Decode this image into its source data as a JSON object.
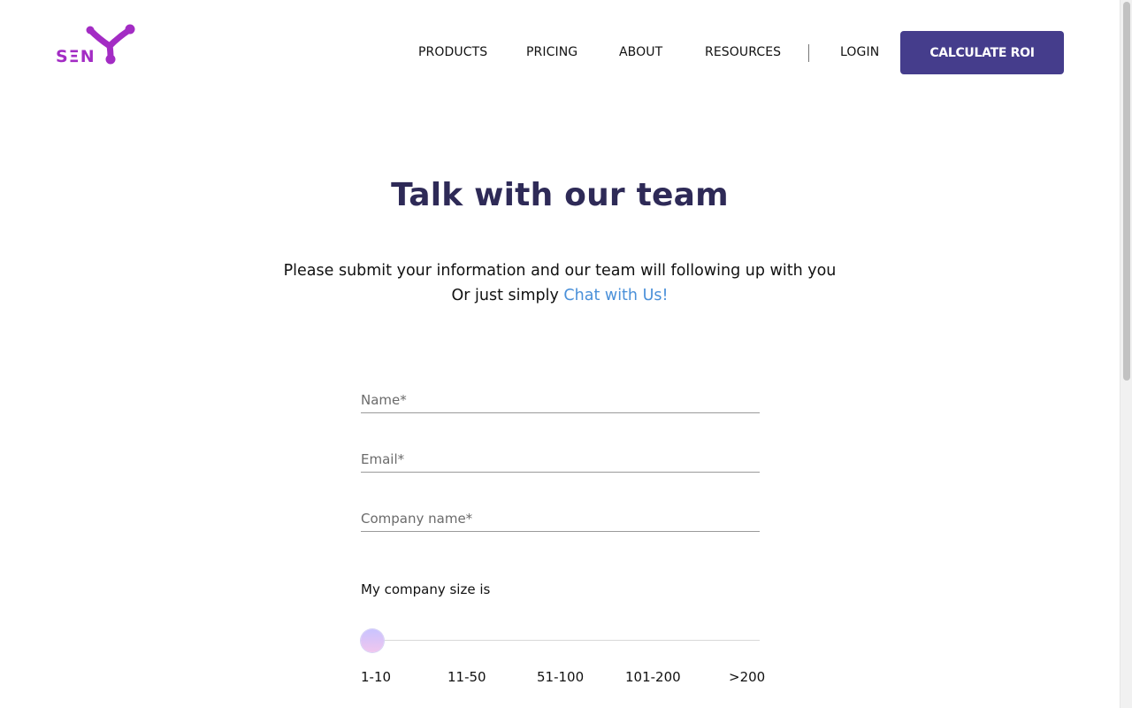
{
  "brand": {
    "logo_text": "SΞN",
    "accent": "#a32cc4"
  },
  "nav": {
    "products": "PRODUCTS",
    "pricing": "PRICING",
    "about": "ABOUT",
    "resources": "RESOURCES",
    "login": "LOGIN",
    "cta": "CALCULATE ROI",
    "cta_color": "#453d8c"
  },
  "hero": {
    "title": "Talk with our team",
    "line1": "Please submit your information and our team will following up with you",
    "line2_prefix": "Or just simply ",
    "chat_link": "Chat with Us!"
  },
  "form": {
    "name_placeholder": "Name*",
    "email_placeholder": "Email*",
    "company_placeholder": "Company name*",
    "size_label": "My company size is",
    "size_options": [
      "1-10",
      "11-50",
      "51-100",
      "101-200",
      ">200"
    ],
    "size_selected": "1-10"
  }
}
